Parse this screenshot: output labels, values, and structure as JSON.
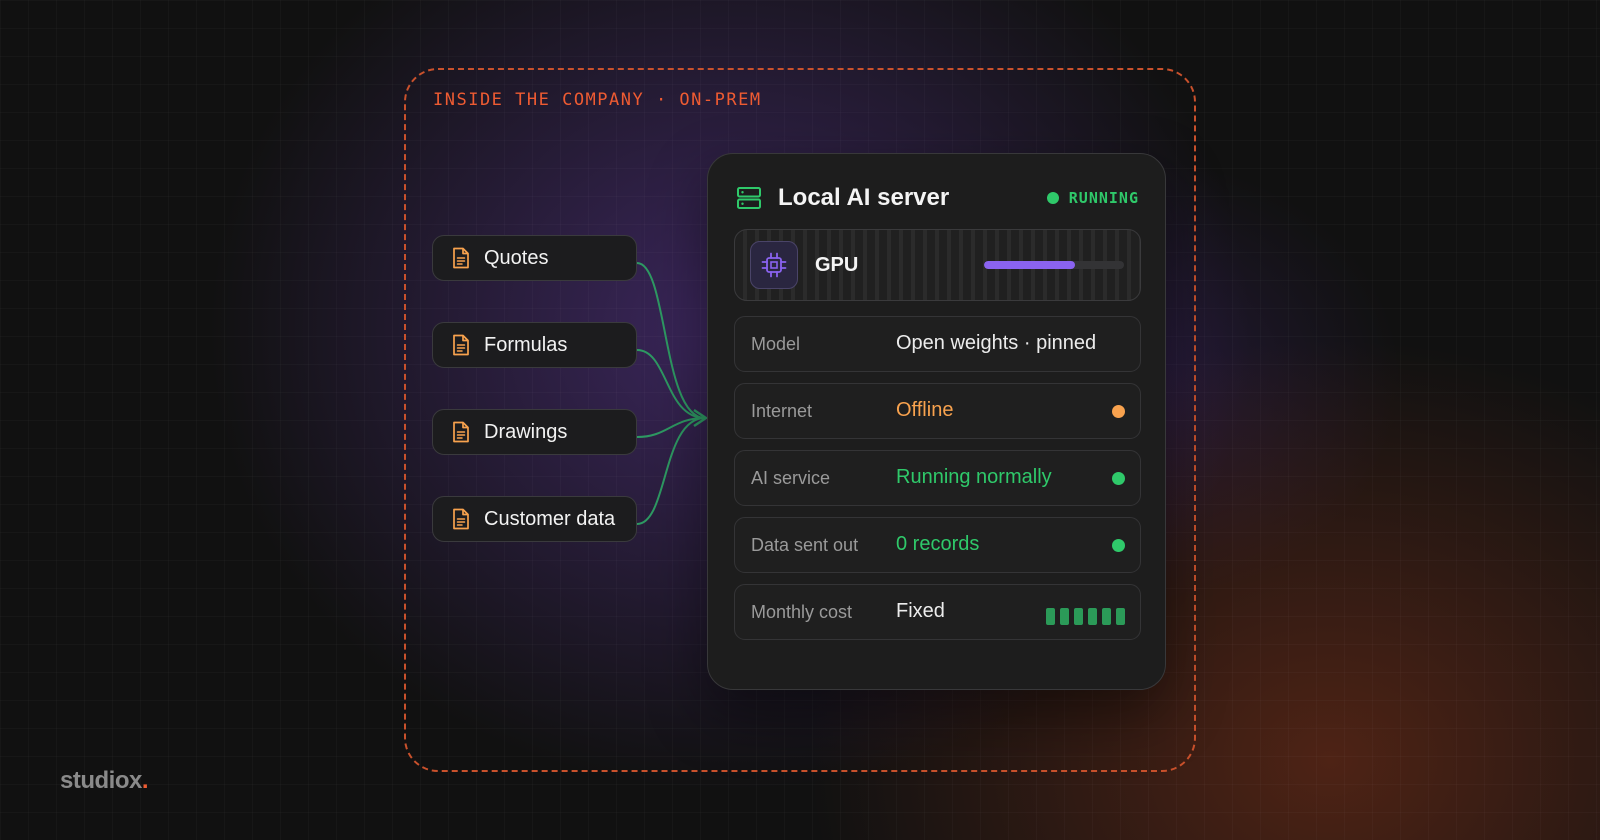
{
  "boundary": {
    "label": "INSIDE THE COMPANY · ON-PREM"
  },
  "documents": [
    {
      "label": "Quotes",
      "icon": "document-icon"
    },
    {
      "label": "Formulas",
      "icon": "document-icon"
    },
    {
      "label": "Drawings",
      "icon": "document-icon"
    },
    {
      "label": "Customer data",
      "icon": "document-icon"
    }
  ],
  "server": {
    "title": "Local AI server",
    "icon": "server-icon",
    "status": "RUNNING",
    "gpu": {
      "label": "GPU",
      "icon": "chip-icon",
      "load_percent": 65
    },
    "rows": [
      {
        "key": "Model",
        "value": "Open weights · pinned",
        "tone": "neutral",
        "indicator": "none"
      },
      {
        "key": "Internet",
        "value": "Offline",
        "tone": "orange",
        "indicator": "dot"
      },
      {
        "key": "AI service",
        "value": "Running normally",
        "tone": "green",
        "indicator": "dot"
      },
      {
        "key": "Data sent out",
        "value": "0 records",
        "tone": "green",
        "indicator": "dot"
      },
      {
        "key": "Monthly cost",
        "value": "Fixed",
        "tone": "neutral",
        "indicator": "bars"
      }
    ]
  },
  "brand": {
    "name": "studiox",
    "suffix": "."
  },
  "colors": {
    "accent_orange": "#ee5b32",
    "status_green": "#2fc96a",
    "warning_orange": "#f8a24e",
    "gpu_purple": "#8a63f0"
  }
}
